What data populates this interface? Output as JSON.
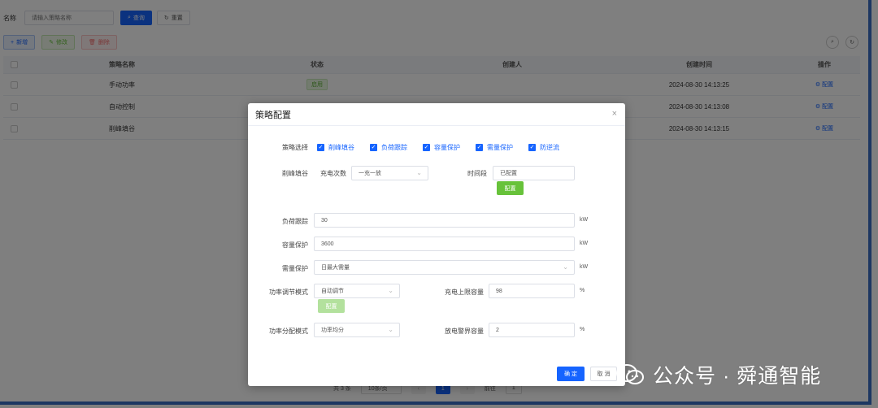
{
  "search": {
    "label": "名称",
    "placeholder": "请输入策略名称",
    "query_label": "查询",
    "reset_label": "重置"
  },
  "toolbar": {
    "add_label": "新增",
    "edit_label": "修改",
    "delete_label": "删除"
  },
  "table": {
    "headers": {
      "name": "策略名称",
      "status": "状态",
      "creator": "创建人",
      "time": "创建时间",
      "op": "操作"
    },
    "rows": [
      {
        "name": "手动功率",
        "status": "启用",
        "creator": "",
        "time": "2024-08-30 14:13:25",
        "op": "配置"
      },
      {
        "name": "自动控制",
        "status": "",
        "creator": "",
        "time": "2024-08-30 14:13:08",
        "op": "配置"
      },
      {
        "name": "削峰填谷",
        "status": "",
        "creator": "",
        "time": "2024-08-30 14:13:15",
        "op": "配置"
      }
    ]
  },
  "pager": {
    "total": "共 3 条",
    "size": "10条/页",
    "prev": "‹",
    "page": "1",
    "next": "›",
    "goto": "前往",
    "goto_page": "1"
  },
  "dialog": {
    "title": "策略配置",
    "close": "×",
    "strategy_label": "策略选择",
    "strategies": [
      "削峰填谷",
      "负荷跟踪",
      "容量保护",
      "需量保护",
      "防逆流"
    ],
    "peak": {
      "label": "削峰填谷",
      "charge_label": "充电次数",
      "charge_value": "一充一放",
      "period_label": "时间段",
      "period_value": "已配置",
      "config_label": "配置"
    },
    "load_track": {
      "label": "负荷跟踪",
      "value": "30",
      "unit": "kW"
    },
    "capacity": {
      "label": "容量保护",
      "value": "3600",
      "unit": "kW"
    },
    "demand": {
      "label": "需量保护",
      "value": "日最大需量",
      "unit": "kW"
    },
    "power_mode": {
      "label": "功率调节模式",
      "value": "自动调节",
      "config_label": "配置"
    },
    "charge_limit": {
      "label": "充电上限容量",
      "value": "98",
      "unit": "%"
    },
    "dist_mode": {
      "label": "功率分配模式",
      "value": "功率均分"
    },
    "discharge_limit": {
      "label": "放电警界容量",
      "value": "2",
      "unit": "%"
    },
    "ok_label": "确 定",
    "cancel_label": "取 消"
  },
  "watermark": {
    "text": "公众号 · 舜通智能"
  },
  "colors": {
    "primary": "#1664ff",
    "success": "#67c23a",
    "danger": "#f56c6c"
  }
}
